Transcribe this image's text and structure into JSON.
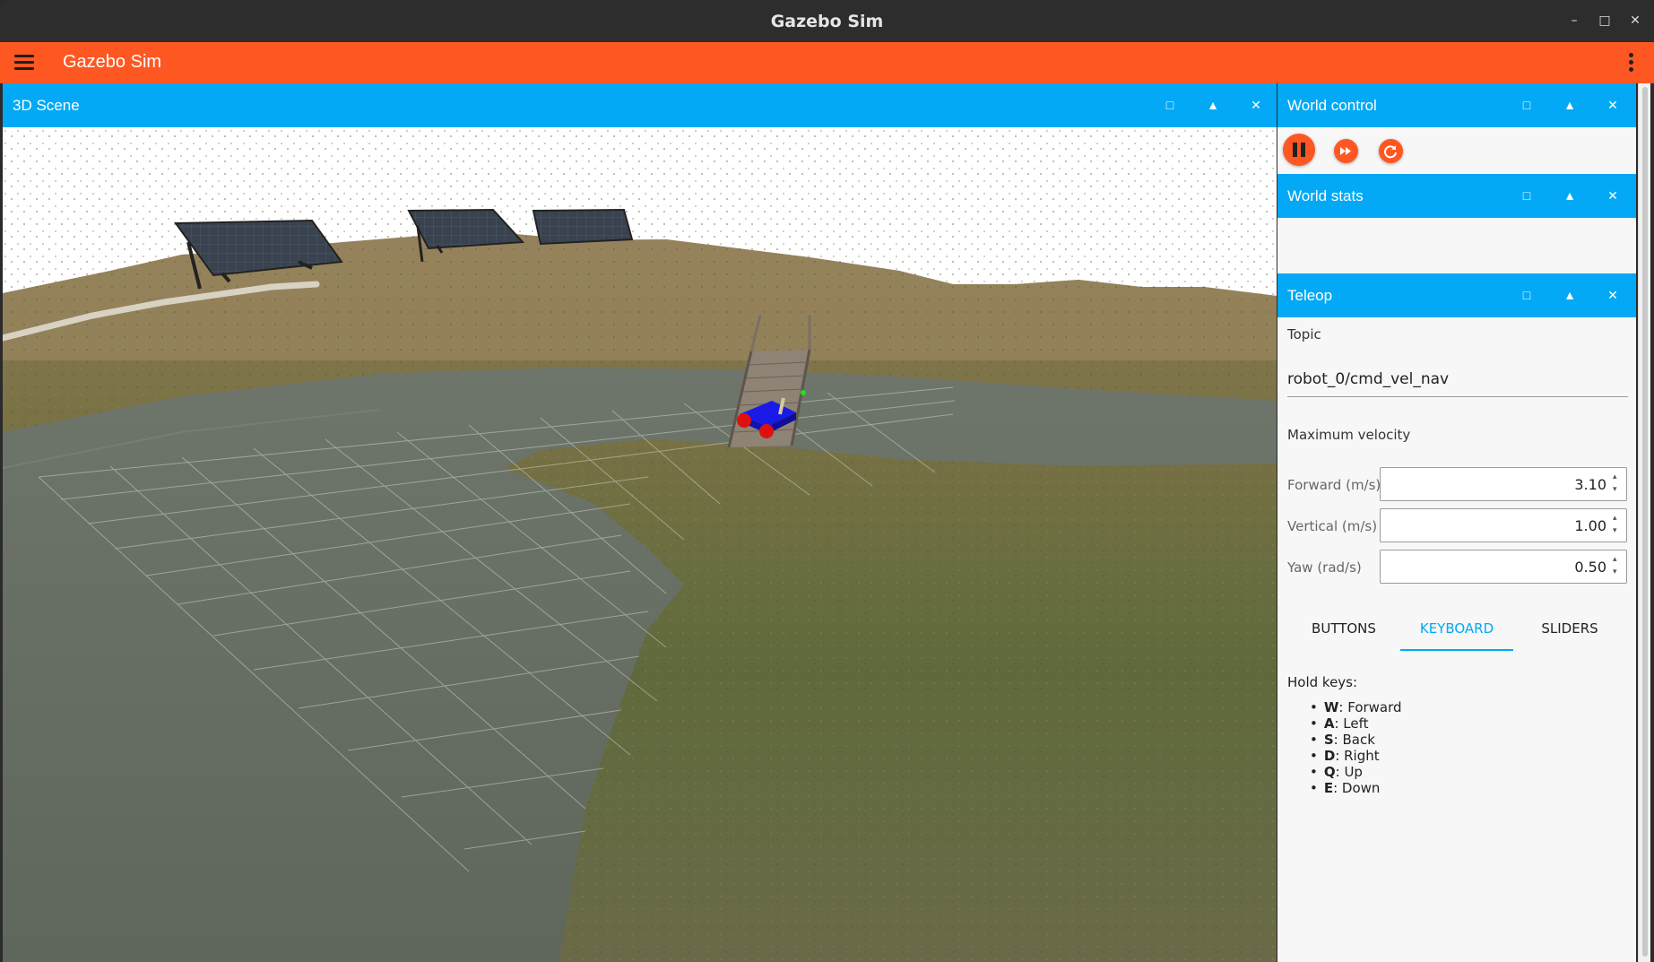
{
  "window": {
    "title": "Gazebo Sim"
  },
  "appbar": {
    "title": "Gazebo Sim"
  },
  "panel_icons": {
    "maximize": "□",
    "collapse": "▲",
    "close": "✕"
  },
  "panels": {
    "scene": {
      "title": "3D Scene"
    },
    "world_control": {
      "title": "World control",
      "play_icon": "pause-icon",
      "step_icon": "fast-forward-icon",
      "reset_icon": "refresh-icon"
    },
    "world_stats": {
      "title": "World stats"
    },
    "teleop": {
      "title": "Teleop",
      "topic_label": "Topic",
      "topic_value": "robot_0/cmd_vel_nav",
      "max_velocity_label": "Maximum velocity",
      "fields": [
        {
          "label": "Forward (m/s)",
          "value": "3.10"
        },
        {
          "label": "Vertical (m/s)",
          "value": "1.00"
        },
        {
          "label": "Yaw (rad/s)",
          "value": "0.50"
        }
      ],
      "tabs": [
        "BUTTONS",
        "KEYBOARD",
        "SLIDERS"
      ],
      "active_tab": "KEYBOARD",
      "hold_keys_label": "Hold keys:",
      "keys": [
        {
          "key": "W",
          "action": ": Forward"
        },
        {
          "key": "A",
          "action": ": Left"
        },
        {
          "key": "S",
          "action": ": Back"
        },
        {
          "key": "D",
          "action": ": Right"
        },
        {
          "key": "Q",
          "action": ": Up"
        },
        {
          "key": "E",
          "action": ": Down"
        }
      ]
    }
  },
  "colors": {
    "appbar": "#ff5722",
    "panel_header": "#03a9f4",
    "accent": "#03a9f4"
  }
}
